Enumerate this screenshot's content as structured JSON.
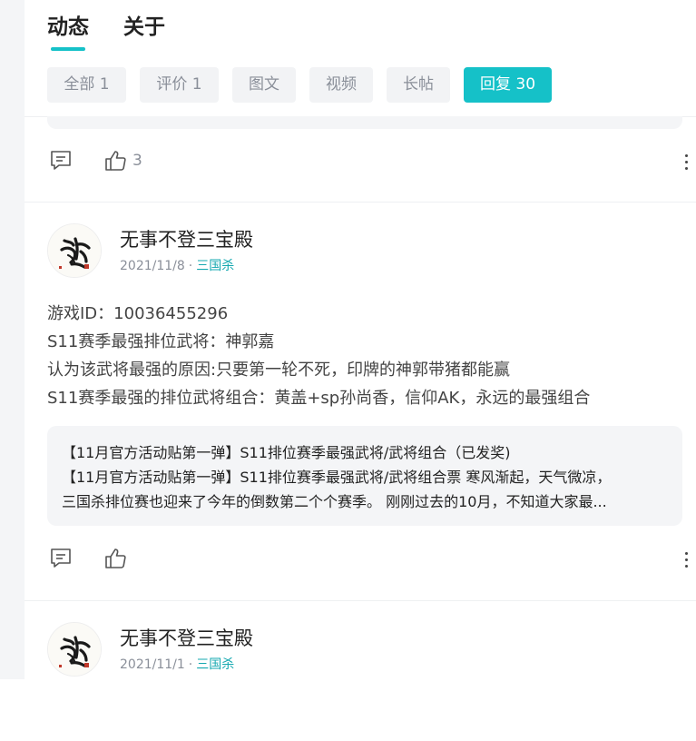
{
  "tabs": [
    {
      "label": "动态",
      "active": true
    },
    {
      "label": "关于",
      "active": false
    }
  ],
  "filters": [
    {
      "label": "全部 1",
      "active": false
    },
    {
      "label": "评价 1",
      "active": false
    },
    {
      "label": "图文",
      "active": false
    },
    {
      "label": "视频",
      "active": false
    },
    {
      "label": "长帖",
      "active": false
    },
    {
      "label": "回复 30",
      "active": true
    }
  ],
  "prev_post": {
    "like_count": "3"
  },
  "posts": [
    {
      "author": "无事不登三宝殿",
      "date": "2021/11/8",
      "separator": "·",
      "forum": "三国杀",
      "lines": [
        "游戏ID：10036455296",
        "S11赛季最强排位武将：神郭嘉",
        "认为该武将最强的原因:只要第一轮不死，印牌的神郭带猪都能赢",
        "S11赛季最强的排位武将组合：黄盖+sp孙尚香，信仰AK，永远的最强组合"
      ],
      "quote": {
        "title": "【11月官方活动贴第一弹】S11排位赛季最强武将/武将组合（已发奖)",
        "excerpt_line1": "【11月官方活动贴第一弹】S11排位赛季最强武将/武将组合票 寒风渐起，天气微凉，",
        "excerpt_line2": "三国杀排位赛也迎来了今年的倒数第二个个赛季。 刚刚过去的10月，不知道大家最..."
      },
      "like_count": ""
    },
    {
      "author": "无事不登三宝殿",
      "date": "2021/11/1",
      "separator": "·",
      "forum": "三国杀"
    }
  ],
  "colors": {
    "accent": "#15c1c8",
    "chip_bg": "#f2f3f5",
    "muted_text": "#8a8f99"
  },
  "icons": {
    "comment": "comment-icon",
    "like": "thumbs-up-icon",
    "more": "more-vertical-icon"
  }
}
